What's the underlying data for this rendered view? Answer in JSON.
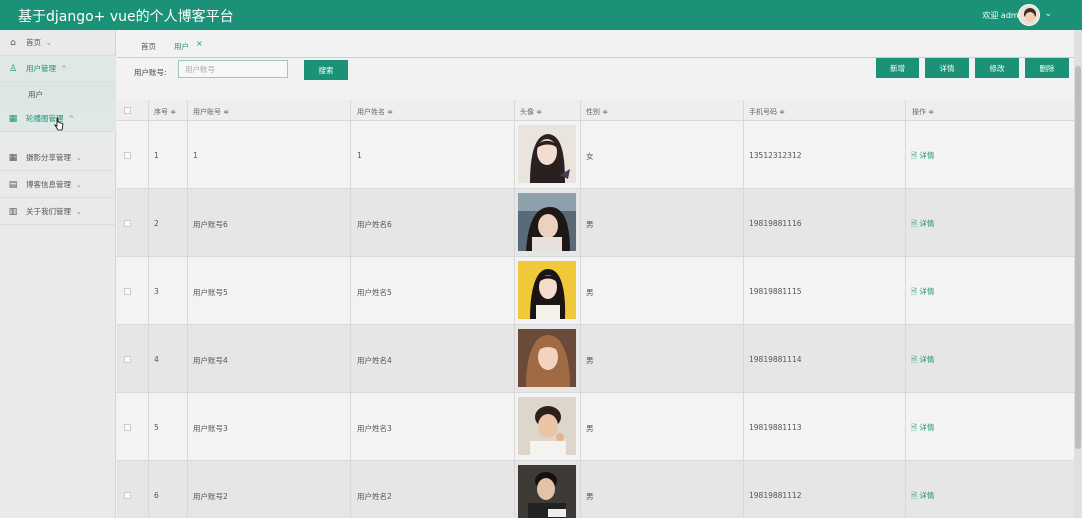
{
  "header": {
    "app_title": "基于django+ vue的个人博客平台",
    "welcome": "欢迎 admin",
    "avatar_icon": "user-avatar",
    "caret_icon": "chevron-down-icon"
  },
  "sidebar": {
    "items": [
      {
        "label": "首页",
        "icon": "home-icon"
      },
      {
        "label": "用户管理",
        "icon": "user-icon"
      },
      {
        "label": "轮播图管理",
        "icon": "grid-icon"
      },
      {
        "label": "摄影分享管理",
        "icon": "grid-icon"
      },
      {
        "label": "博客信息管理",
        "icon": "doc-icon"
      },
      {
        "label": "关于我们管理",
        "icon": "book-icon"
      }
    ],
    "submenu": {
      "label": "用户"
    }
  },
  "tabs": [
    {
      "label": "首页"
    },
    {
      "label": "用户"
    }
  ],
  "search": {
    "label": "用户账号:",
    "placeholder": "用户账号",
    "button": "搜索"
  },
  "actions": {
    "add": "新增",
    "detail": "详情",
    "edit": "修改",
    "delete": "删除"
  },
  "table": {
    "headers": {
      "index": "序号 ≑",
      "account": "用户账号 ≑",
      "name": "用户姓名 ≑",
      "avatar": "头像 ≑",
      "gender": "性别 ≑",
      "phone": "手机号码 ≑",
      "ops": "操作 ≑"
    },
    "rows": [
      {
        "index": "1",
        "account": "1",
        "name": "1",
        "gender": "女",
        "phone": "13512312312",
        "action": "详情"
      },
      {
        "index": "2",
        "account": "用户账号6",
        "name": "用户姓名6",
        "gender": "男",
        "phone": "19819881116",
        "action": "详情"
      },
      {
        "index": "3",
        "account": "用户账号5",
        "name": "用户姓名5",
        "gender": "男",
        "phone": "19819881115",
        "action": "详情"
      },
      {
        "index": "4",
        "account": "用户账号4",
        "name": "用户姓名4",
        "gender": "男",
        "phone": "19819881114",
        "action": "详情"
      },
      {
        "index": "5",
        "account": "用户账号3",
        "name": "用户姓名3",
        "gender": "男",
        "phone": "19819881113",
        "action": "详情"
      },
      {
        "index": "6",
        "account": "用户账号2",
        "name": "用户姓名2",
        "gender": "男",
        "phone": "19819881112",
        "action": "详情"
      }
    ]
  },
  "colors": {
    "accent": "#1b9278"
  }
}
